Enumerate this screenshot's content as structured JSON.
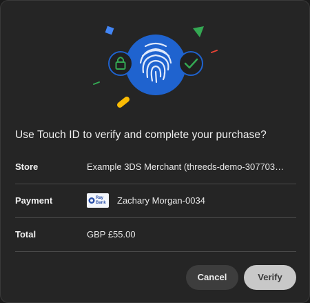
{
  "dialog": {
    "title": "Use Touch ID to verify and complete your purchase?"
  },
  "details": {
    "store_label": "Store",
    "store_value": "Example 3DS Merchant (threeds-demo-307703…",
    "payment_label": "Payment",
    "payment_value": "Zachary Morgan-0034",
    "card_logo_text_1": "Ray",
    "card_logo_text_2": "Bank",
    "total_label": "Total",
    "total_value": "GBP £55.00"
  },
  "buttons": {
    "cancel_label": "Cancel",
    "verify_label": "Verify"
  },
  "icons": {
    "hero": "fingerprint-icon",
    "lock": "lock-icon",
    "check": "checkmark-icon"
  },
  "colors": {
    "fingerprint_circle": "#1f63cf",
    "lock_green": "#34a853",
    "check_green": "#34a853",
    "confetti_blue": "#4285f4",
    "confetti_green": "#34a853",
    "confetti_red": "#ea4335",
    "confetti_yellow": "#fbbc04",
    "verify_button_bg": "#c8c8c8",
    "cancel_button_bg": "#3d3d3d"
  }
}
